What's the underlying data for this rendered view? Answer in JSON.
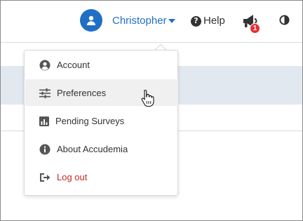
{
  "header": {
    "user_name": "Christopher",
    "help_label": "Help",
    "notification_count": "1"
  },
  "dropdown": {
    "items": [
      {
        "label": "Account",
        "icon": "user-circle-icon"
      },
      {
        "label": "Preferences",
        "icon": "sliders-icon"
      },
      {
        "label": "Pending Surveys",
        "icon": "bar-chart-icon"
      },
      {
        "label": "About Accudemia",
        "icon": "info-circle-icon"
      },
      {
        "label": "Log out",
        "icon": "sign-out-icon"
      }
    ],
    "hovered_item": "Preferences"
  },
  "colors": {
    "accent": "#1f6fc5",
    "badge": "#e53030",
    "logout": "#c62828",
    "band": "#e2e8f0"
  }
}
